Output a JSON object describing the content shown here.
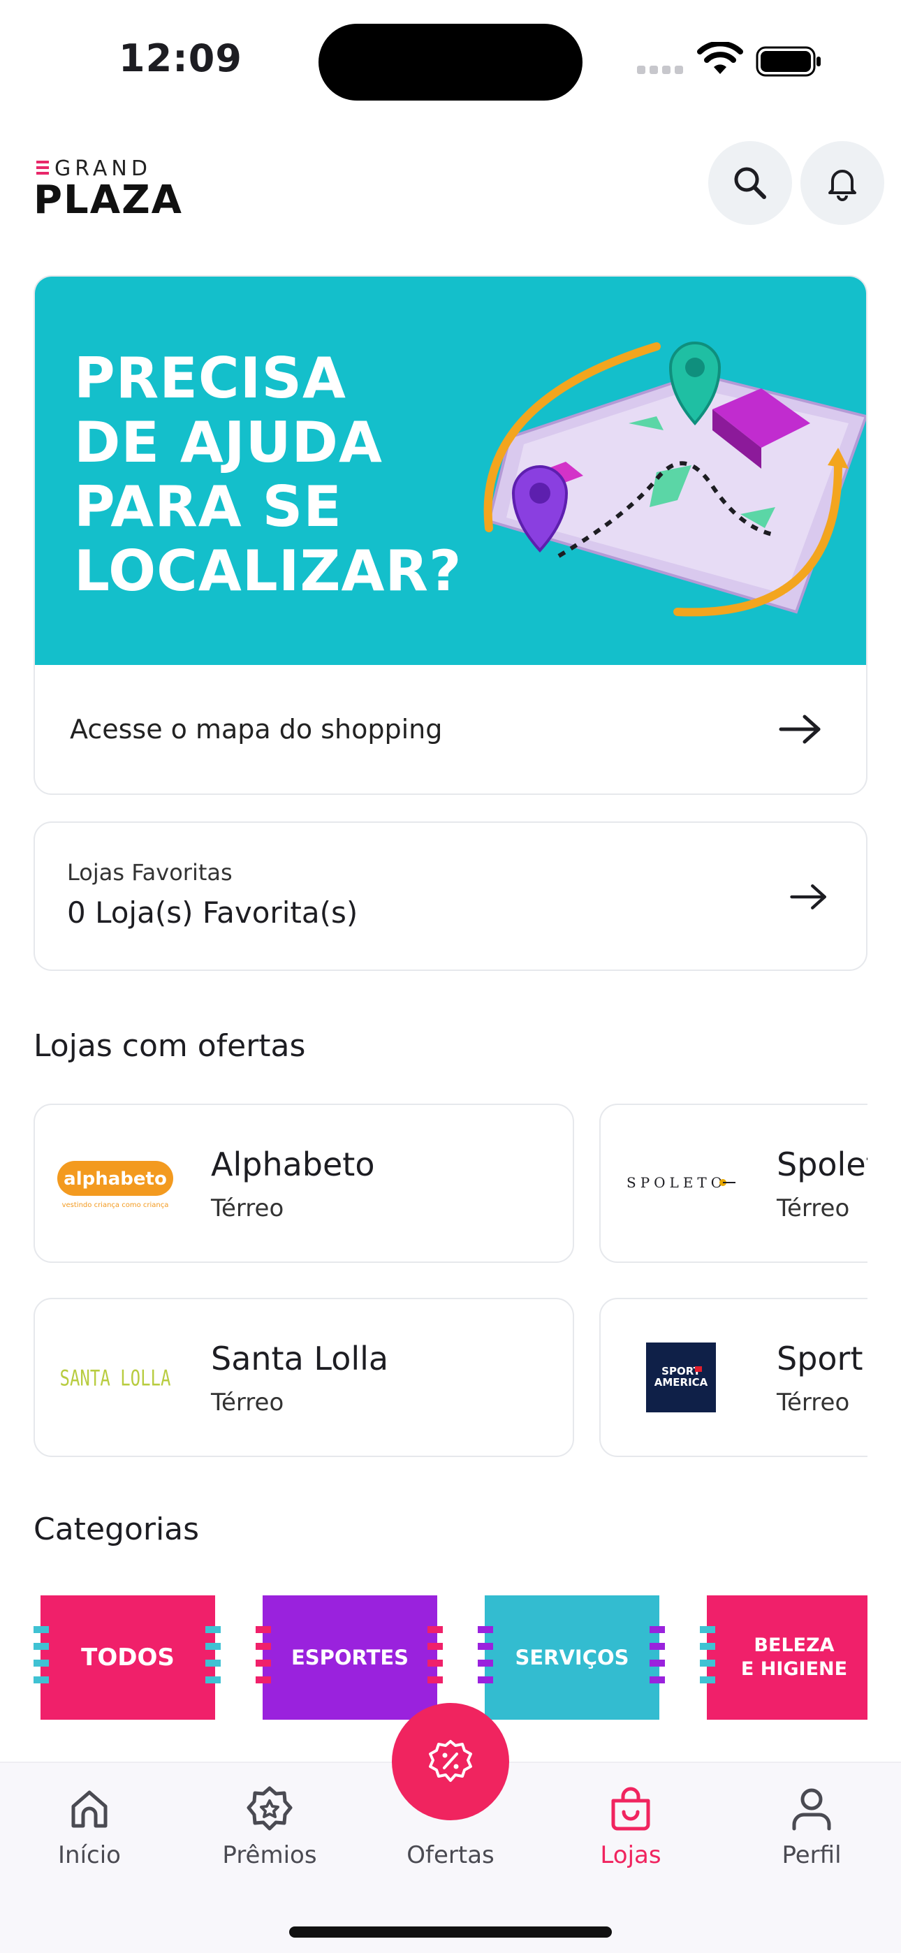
{
  "status_bar": {
    "time": "12:09"
  },
  "header": {
    "logo_top": "GRAND",
    "logo_bottom": "PLAZA",
    "search_icon": "search-icon",
    "bell_icon": "bell-icon"
  },
  "banner": {
    "headline_lines": [
      "PRECISA",
      "DE AJUDA",
      "PARA SE",
      "LOCALIZAR?"
    ],
    "link_label": "Acesse o mapa do shopping",
    "background_color": "#14bfcb"
  },
  "favorites": {
    "title": "Lojas Favoritas",
    "count_label": "0 Loja(s) Favorita(s)"
  },
  "stores_section": {
    "title": "Lojas com ofertas",
    "stores": [
      {
        "name": "Alphabeto",
        "floor": "Térreo",
        "logo_text": "alphabeto",
        "logo_tagline": "vestindo criança como criança"
      },
      {
        "name": "Spoleto",
        "floor": "Térreo",
        "logo_text": "SPOLETO"
      },
      {
        "name": "Santa Lolla",
        "floor": "Térreo",
        "logo_text": "SANTA LOLLA"
      },
      {
        "name": "Sport America",
        "floor": "Térreo",
        "logo_text_1": "SPORT",
        "logo_text_2": "AMERICA"
      }
    ]
  },
  "categories_section": {
    "title": "Categorias",
    "items": [
      {
        "label": "TODOS",
        "color": "#f0206a"
      },
      {
        "label": "ESPORTES",
        "color": "#9a22dd"
      },
      {
        "label": "SERVIÇOS",
        "color": "#33bcd0"
      },
      {
        "label_1": "BELEZA",
        "label_2": "E HIGIENE",
        "color": "#f0206a"
      }
    ]
  },
  "bottom_nav": {
    "items": [
      {
        "label": "Início",
        "icon": "home-icon"
      },
      {
        "label": "Prêmios",
        "icon": "award-icon"
      },
      {
        "label": "Ofertas",
        "icon": "discount-badge-icon"
      },
      {
        "label": "Lojas",
        "icon": "shopping-bag-icon"
      },
      {
        "label": "Perfil",
        "icon": "user-icon"
      }
    ],
    "active": "Lojas",
    "accent_color": "#f0245f"
  }
}
